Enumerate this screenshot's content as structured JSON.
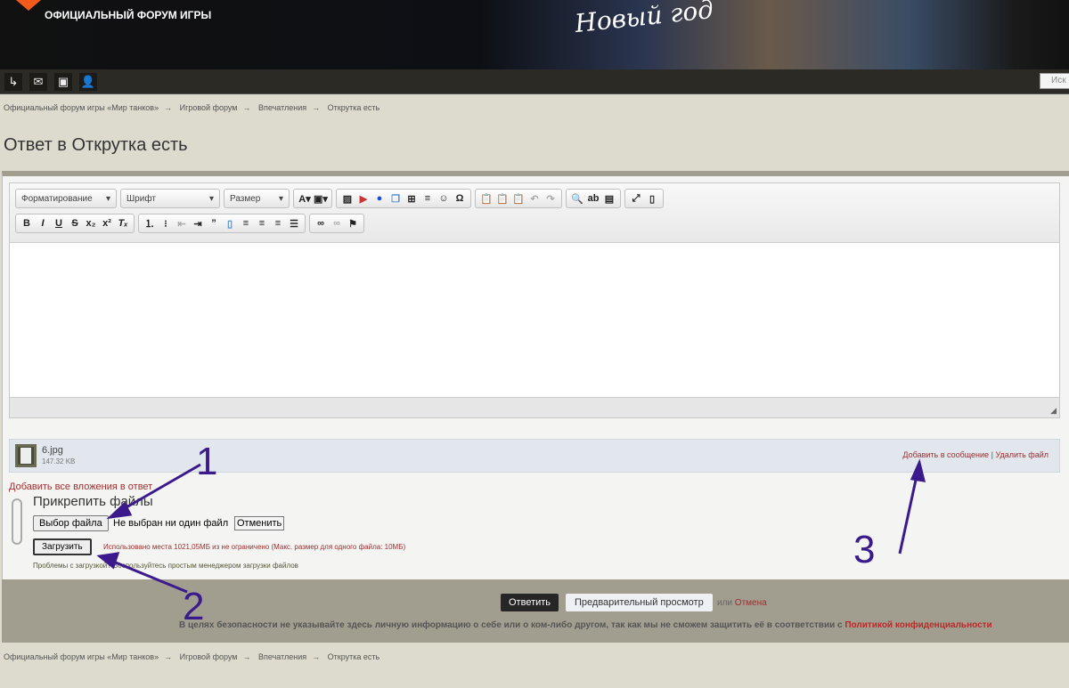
{
  "header": {
    "site_title": "ОФИЦИАЛЬНЫЙ ФОРУМ ИГРЫ",
    "banner_text": "Новый год",
    "search_placeholder": "Иск"
  },
  "nav_icons": [
    "exit-icon",
    "mail-icon",
    "contacts-icon",
    "user-icon"
  ],
  "breadcrumb": [
    "Официальный форум игры «Мир танков»",
    "Игровой форум",
    "Впечатления",
    "Открутка есть"
  ],
  "breadcrumb_sep": "→",
  "page_title": "Ответ в Открутка есть",
  "editor": {
    "format_label": "Форматирование",
    "font_label": "Шрифт",
    "size_label": "Размер"
  },
  "attachment": {
    "name": "6.jpg",
    "size": "147.32 KB",
    "add_to_post": "Добавить в сообщение",
    "separator": "|",
    "delete": "Удалить файл"
  },
  "add_all_link": "Добавить все вложения в ответ",
  "upload": {
    "heading": "Прикрепить файлы",
    "choose_button": "Выбор файла",
    "no_file": "Не выбран ни один файл",
    "cancel_button": "Отменить",
    "upload_button": "Загрузить",
    "quota": "Использовано места 1021,05МБ из не ограничено (Макс. размер для одного файла: 10МБ)",
    "problems": "Проблемы с загрузкой? Воспользуйтесь простым менеджером загрузки файлов"
  },
  "actions": {
    "reply": "Ответить",
    "preview": "Предварительный просмотр",
    "or": "или",
    "cancel": "Отмена"
  },
  "privacy": {
    "text": "В целях безопасности не указывайте здесь личную информацию о себе или о ком-либо другом, так как мы не сможем защитить её в соответствии с ",
    "link": "Политикой конфиденциальности"
  },
  "annotations": [
    "1",
    "2",
    "3"
  ],
  "colors": {
    "annotation": "#3b1a8c",
    "link": "#9b2f2f"
  }
}
